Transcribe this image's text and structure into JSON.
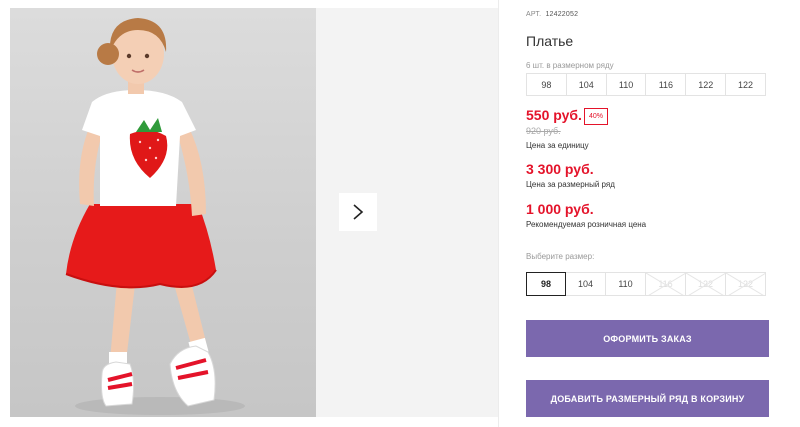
{
  "gallery": {
    "next_icon": "chevron-right-icon"
  },
  "product": {
    "art_label": "АРТ.",
    "art_number": "12422052",
    "title": "Платье",
    "pack_note": "6 шт. в размерном ряду",
    "pack_sizes": [
      "98",
      "104",
      "110",
      "116",
      "122",
      "122"
    ]
  },
  "prices": {
    "unit_price": "550 руб.",
    "discount": "40%",
    "old_price": "920 руб.",
    "unit_label": "Цена за единицу",
    "pack_price": "3 300 руб.",
    "pack_label": "Цена за размерный ряд",
    "retail_price": "1 000 руб.",
    "retail_label": "Рекомендуемая розничная цена"
  },
  "size_select": {
    "label": "Выберите размер:",
    "options": [
      {
        "label": "98",
        "state": "selected"
      },
      {
        "label": "104",
        "state": "available"
      },
      {
        "label": "110",
        "state": "available"
      },
      {
        "label": "116",
        "state": "unavailable"
      },
      {
        "label": "122",
        "state": "unavailable"
      },
      {
        "label": "122",
        "state": "unavailable"
      }
    ]
  },
  "actions": {
    "order_label": "ОФОРМИТЬ ЗАКАЗ",
    "add_to_cart_label": "ДОБАВИТЬ РАЗМЕРНЫЙ РЯД В КОРЗИНУ"
  },
  "colors": {
    "accent": "#7b68ae",
    "price_red": "#e4132a"
  }
}
